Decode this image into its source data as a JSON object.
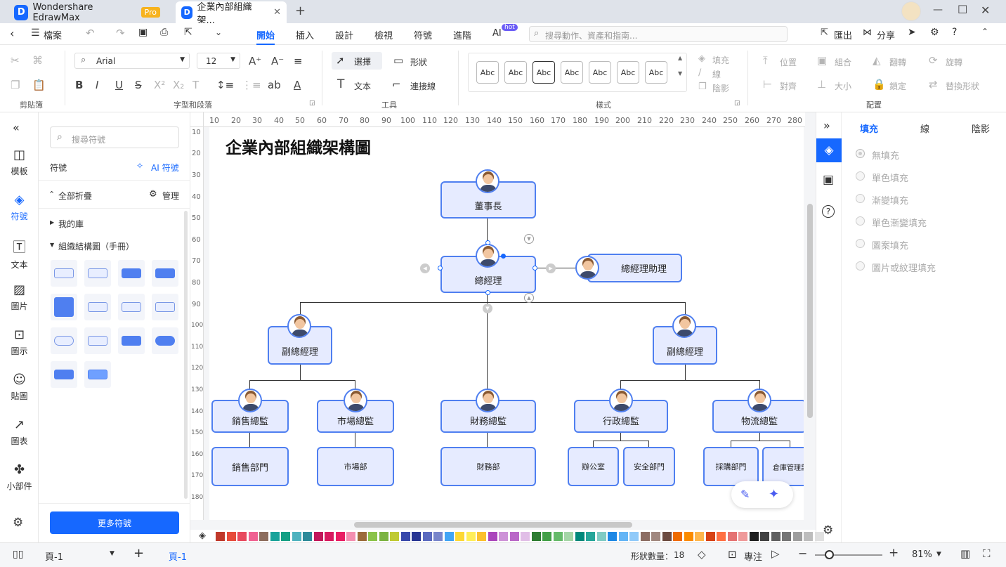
{
  "titlebar": {
    "app_name": "Wondershare EdrawMax",
    "pro_badge": "Pro",
    "doc_tab": "企業內部組織架...",
    "new_tab_icon": "plus-icon"
  },
  "menubar": {
    "file": "檔案",
    "tabs": [
      "開始",
      "插入",
      "設計",
      "檢視",
      "符號",
      "進階",
      "AI"
    ],
    "active_tab": "開始",
    "ai_badge": "hot",
    "search_placeholder": "搜尋動作、資產和指南...",
    "export": "匯出",
    "share": "分享"
  },
  "ribbon": {
    "groups": [
      "剪貼簿",
      "字型和段落",
      "工具",
      "樣式",
      "配置"
    ],
    "font_name": "Arial",
    "font_size": "12",
    "select": "選擇",
    "shape": "形狀",
    "text": "文本",
    "connector": "連接線",
    "style_samples": [
      "Abc",
      "Abc",
      "Abc",
      "Abc",
      "Abc",
      "Abc",
      "Abc"
    ],
    "fill": "填充",
    "line": "線",
    "shadow": "陰影",
    "position": "位置",
    "group": "組合",
    "flip": "翻轉",
    "rotate": "旋轉",
    "align": "對齊",
    "size": "大小",
    "lock": "鎖定",
    "replace": "替換形狀"
  },
  "leftbar": [
    {
      "label": "模板",
      "icon": "template-icon"
    },
    {
      "label": "符號",
      "icon": "symbol-icon"
    },
    {
      "label": "文本",
      "icon": "text-icon"
    },
    {
      "label": "圖片",
      "icon": "image-icon"
    },
    {
      "label": "圖示",
      "icon": "icon-icon"
    },
    {
      "label": "貼圖",
      "icon": "sticker-icon"
    },
    {
      "label": "圖表",
      "icon": "chart-icon"
    },
    {
      "label": "小部件",
      "icon": "widget-icon"
    }
  ],
  "symbols": {
    "search_placeholder": "搜尋符號",
    "title": "符號",
    "ai_symbols": "AI 符號",
    "collapse_all": "全部折疊",
    "manage": "管理",
    "my_library": "我的庫",
    "org_chart": "組織結構圖（手冊）",
    "more_symbols": "更多符號"
  },
  "diagram": {
    "title": "企業內部組織架構圖",
    "nodes": {
      "chairman": "董事長",
      "gm": "總經理",
      "assistant": "總經理助理",
      "vp1": "副總經理",
      "vp2": "副總經理",
      "sales_dir": "銷售總監",
      "market_dir": "市場總監",
      "finance_dir": "財務總監",
      "admin_dir": "行政總監",
      "logistics_dir": "物流總監",
      "sales_dept": "銷售部門",
      "market_dept": "市場部",
      "finance_dept": "財務部",
      "office": "辦公室",
      "security": "安全部門",
      "purchase": "採購部門",
      "warehouse": "倉庫管理部"
    }
  },
  "rulers": {
    "h": [
      "10",
      "20",
      "30",
      "40",
      "50",
      "60",
      "70",
      "80",
      "90",
      "100",
      "110",
      "120",
      "130",
      "140",
      "150",
      "160",
      "170",
      "180",
      "190",
      "200",
      "210",
      "220",
      "230",
      "240",
      "250",
      "260",
      "270",
      "280"
    ],
    "v": [
      "10",
      "20",
      "30",
      "40",
      "50",
      "60",
      "70",
      "80",
      "90",
      "100",
      "110",
      "120",
      "130",
      "140",
      "150",
      "160",
      "170",
      "180"
    ]
  },
  "rightpanel": {
    "tabs": [
      "填充",
      "線",
      "陰影"
    ],
    "active_tab": "填充",
    "options": [
      "無填充",
      "單色填充",
      "漸變填充",
      "單色漸變填充",
      "圖案填充",
      "圖片或紋理填充"
    ]
  },
  "statusbar": {
    "page_select": "頁-1",
    "page_tab": "頁-1",
    "shape_count_label": "形狀數量：",
    "shape_count": "18",
    "focus": "專注",
    "zoom": "81%"
  },
  "palette": [
    "#c0392b",
    "#e74c3c",
    "#e84a5f",
    "#f06292",
    "#8e6e5e",
    "#1aa39a",
    "#16a085",
    "#4fb3bf",
    "#2e8b9a",
    "#c2185b",
    "#d81b60",
    "#e91e63",
    "#f48fb1",
    "#9c6b3b",
    "#8bc34a",
    "#7cb342",
    "#c0ca33",
    "#3949ab",
    "#283593",
    "#5c6bc0",
    "#7986cb",
    "#42a5f5",
    "#fdd835",
    "#ffee58",
    "#fbc02d",
    "#ab47bc",
    "#ce93d8",
    "#ba68c8",
    "#e1bee7",
    "#2e7d32",
    "#43a047",
    "#66bb6a",
    "#a5d6a7",
    "#00897b",
    "#26a69a",
    "#80cbc4",
    "#1e88e5",
    "#64b5f6",
    "#90caf9",
    "#8d6e63",
    "#a1887f",
    "#6d4c41",
    "#ef6c00",
    "#fb8c00",
    "#ffb74d",
    "#d84315",
    "#ff7043",
    "#e57373",
    "#ef9a9a",
    "#212121",
    "#424242",
    "#616161",
    "#757575",
    "#9e9e9e",
    "#bdbdbd",
    "#e0e0e0"
  ]
}
